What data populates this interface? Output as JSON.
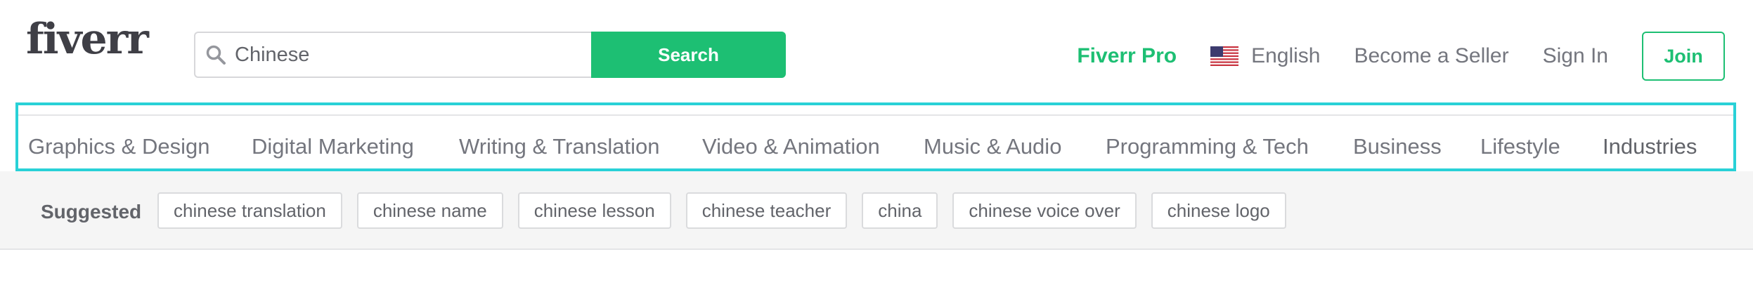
{
  "header": {
    "logo": "fiverr",
    "search": {
      "value": "Chinese",
      "button_label": "Search"
    },
    "nav": {
      "pro": "Fiverr Pro",
      "language": "English",
      "become_seller": "Become a Seller",
      "sign_in": "Sign In",
      "join": "Join"
    }
  },
  "categories": [
    "Graphics & Design",
    "Digital Marketing",
    "Writing & Translation",
    "Video & Animation",
    "Music & Audio",
    "Programming & Tech",
    "Business",
    "Lifestyle",
    "Industries"
  ],
  "suggested": {
    "label": "Suggested",
    "chips": [
      "chinese translation",
      "chinese name",
      "chinese lesson",
      "chinese teacher",
      "china",
      "chinese voice over",
      "chinese logo"
    ]
  },
  "colors": {
    "brand_green": "#1dbf73",
    "highlight": "#29d1d7"
  }
}
